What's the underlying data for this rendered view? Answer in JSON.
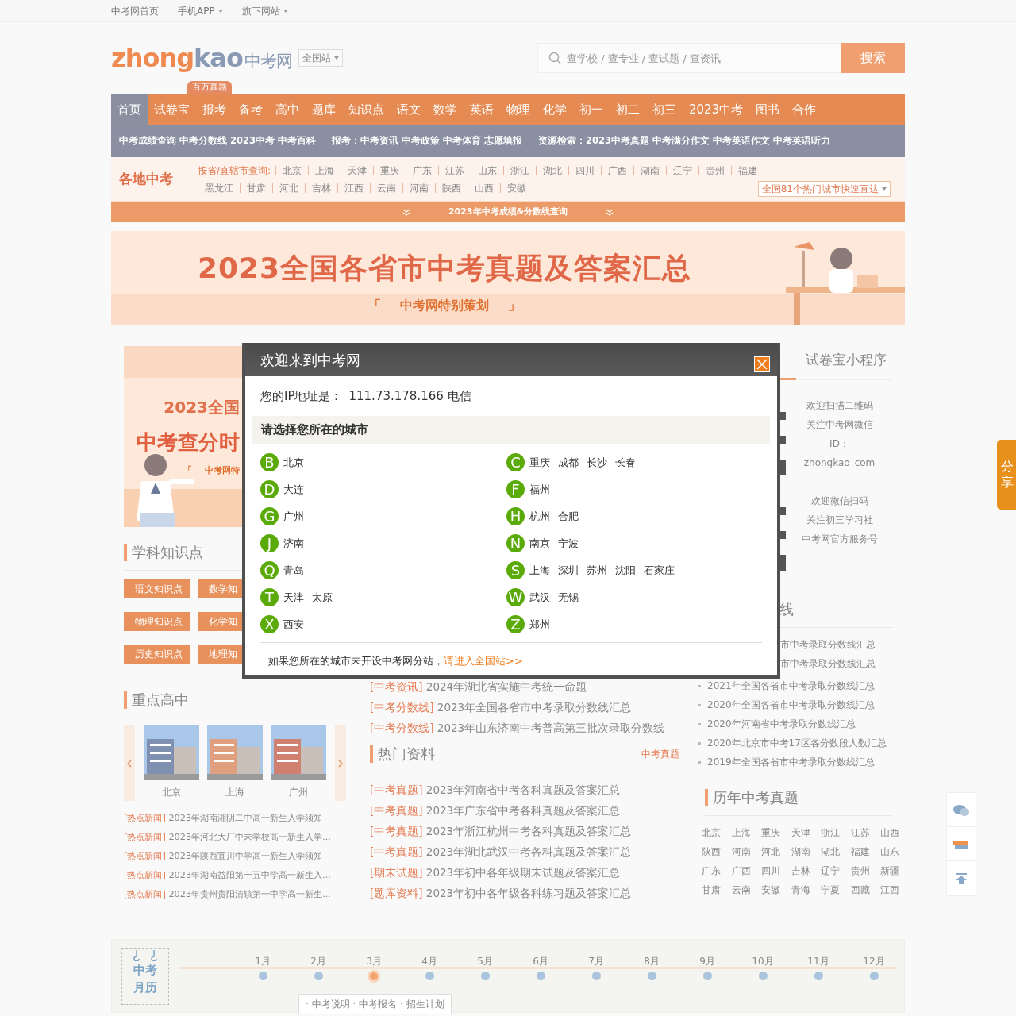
{
  "top_links": [
    {
      "label": "中考网首页",
      "dropdown": false
    },
    {
      "label": "手机APP",
      "dropdown": true
    },
    {
      "label": "旗下网站",
      "dropdown": true
    }
  ],
  "header": {
    "logo_a": "zhong",
    "logo_b": "kao",
    "logo_cn": "中考网",
    "site": "全国站",
    "search_placeholder": "查学校 / 查专业 / 查试题 / 查资讯",
    "search_button": "搜索"
  },
  "nav": {
    "badge": "百万真题",
    "items": [
      {
        "label": "首页",
        "selected": true
      },
      {
        "label": "试卷宝",
        "selected": false
      },
      {
        "label": "报考",
        "selected": false
      },
      {
        "label": "备考",
        "selected": false
      },
      {
        "label": "高中",
        "selected": false
      },
      {
        "label": "题库",
        "selected": false
      },
      {
        "label": "知识点",
        "selected": false
      },
      {
        "label": "语文",
        "selected": false
      },
      {
        "label": "数学",
        "selected": false
      },
      {
        "label": "英语",
        "selected": false
      },
      {
        "label": "物理",
        "selected": false
      },
      {
        "label": "化学",
        "selected": false
      },
      {
        "label": "初一",
        "selected": false
      },
      {
        "label": "初二",
        "selected": false
      },
      {
        "label": "初三",
        "selected": false
      },
      {
        "label": "2023中考",
        "selected": false
      },
      {
        "label": "图书",
        "selected": false
      },
      {
        "label": "合作",
        "selected": false
      }
    ]
  },
  "subnav": [
    {
      "links": [
        "中考成绩查询",
        "中考分数线",
        "2023中考",
        "中考百科"
      ]
    },
    {
      "label": "报考：",
      "links": [
        "中考资讯",
        "中考政策",
        "中考体育",
        "志愿填报"
      ]
    },
    {
      "label": "资源检索：",
      "links": [
        "2023中考真题",
        "中考满分作文",
        "中考英语作文",
        "中考英语听力"
      ]
    }
  ],
  "regions": {
    "title": "各地中考",
    "label": "按省/直辖市查询:",
    "cities": [
      "北京",
      "上海",
      "天津",
      "重庆",
      "广东",
      "江苏",
      "山东",
      "浙江",
      "湖北",
      "四川",
      "广西",
      "湖南",
      "辽宁",
      "贵州",
      "福建",
      "黑龙江",
      "甘肃",
      "河北",
      "吉林",
      "江西",
      "云南",
      "河南",
      "陕西",
      "山西",
      "安徽"
    ],
    "quick": "全国81个热门城市快速直达"
  },
  "score_bar": "2023年中考成绩&分数线查询",
  "banner": {
    "title": "2023全国各省市中考真题及答案汇总",
    "bracket_open": "「",
    "subtitle": "中考网特别策划",
    "bracket_close": "」"
  },
  "left": {
    "promo": {
      "line1": "2023全国",
      "line2": "中考查分时",
      "bracket": "「",
      "line3": "中考网特"
    },
    "subjects": {
      "title": "学科知识点",
      "buttons": [
        "语文知识点",
        "数学知",
        "物理知识点",
        "化学知",
        "历史知识点",
        "地理知"
      ]
    },
    "schools": {
      "title": "重点高中",
      "items": [
        {
          "kind": "picture",
          "city": "北京"
        },
        {
          "kind": "picture",
          "city": "上海"
        },
        {
          "kind": "picture",
          "city": "广州"
        }
      ]
    },
    "news": [
      {
        "tag": "[热点新闻]",
        "title": "2023年湖南湘阴二中高一新生入学须知"
      },
      {
        "tag": "[热点新闻]",
        "title": "2023年河北大厂中未学校高一新生入学..."
      },
      {
        "tag": "[热点新闻]",
        "title": "2023年陕西宜川中学高一新生入学须知"
      },
      {
        "tag": "[热点新闻]",
        "title": "2023年湖南益阳第十五中学高一新生入..."
      },
      {
        "tag": "[热点新闻]",
        "title": "2023年贵州贵阳清镇第一中学高一新生..."
      }
    ]
  },
  "middle": {
    "news": [
      {
        "tag": "[中考资讯]",
        "title": "2024年湖北省实施中考统一命题"
      },
      {
        "tag": "[中考分数线]",
        "title": "2023年全国各省市中考录取分数线汇总"
      },
      {
        "tag": "[中考分数线]",
        "title": "2023年山东济南中考普高第三批次录取分数线"
      }
    ],
    "hot": {
      "title": "热门资料",
      "more": "中考真题",
      "items": [
        {
          "tag": "[中考真题]",
          "title": "2023年河南省中考各科真题及答案汇总"
        },
        {
          "tag": "[中考真题]",
          "title": "2023年广东省中考各科真题及答案汇总"
        },
        {
          "tag": "[中考真题]",
          "title": "2023年浙江杭州中考各科真题及答案汇总"
        },
        {
          "tag": "[中考真题]",
          "title": "2023年湖北武汉中考各科真题及答案汇总"
        },
        {
          "tag": "[期末试题]",
          "title": "2023年初中各年级期末试题及答案汇总"
        },
        {
          "tag": "[题库资料]",
          "title": "2023年初中各年级各科练习题及答案汇总"
        }
      ]
    }
  },
  "right": {
    "tab": "试卷宝小程序",
    "qr": [
      {
        "lines": [
          "欢迎扫描二维码",
          "关注中考网微信",
          "ID：",
          "zhongkao_com"
        ]
      },
      {
        "lines": [
          "欢迎微信扫码",
          "关注初三学习社",
          "中考网官方服务号"
        ]
      }
    ],
    "scores": {
      "title_cut": "线",
      "items_cut": [
        "市中考录取分数线汇总",
        "市中考录取分数线汇总"
      ],
      "items": [
        "2021年全国各省市中考录取分数线汇总",
        "2020年全国各省市中考录取分数线汇总",
        "2020年河南省中考录取分数线汇总",
        "2020年北京市中考17区各分数段人数汇总",
        "2019年全国各省市中考录取分数线汇总"
      ]
    },
    "years": {
      "title": "历年中考真题",
      "provinces": [
        "北京",
        "上海",
        "重庆",
        "天津",
        "浙江",
        "江苏",
        "山西",
        "陕西",
        "河南",
        "河北",
        "湖南",
        "湖北",
        "福建",
        "山东",
        "广东",
        "广西",
        "四川",
        "吉林",
        "辽宁",
        "贵州",
        "新疆",
        "甘肃",
        "云南",
        "安徽",
        "青海",
        "宁夏",
        "西藏",
        "江西"
      ]
    }
  },
  "share": "分享",
  "calendar": {
    "title_top": "中考",
    "title_bottom": "月历",
    "months": [
      {
        "label": "1月",
        "selected": false
      },
      {
        "label": "2月",
        "selected": false
      },
      {
        "label": "3月",
        "selected": true
      },
      {
        "label": "4月",
        "selected": false
      },
      {
        "label": "5月",
        "selected": false
      },
      {
        "label": "6月",
        "selected": false
      },
      {
        "label": "7月",
        "selected": false
      },
      {
        "label": "8月",
        "selected": false
      },
      {
        "label": "9月",
        "selected": false
      },
      {
        "label": "10月",
        "selected": false
      },
      {
        "label": "11月",
        "selected": false
      },
      {
        "label": "12月",
        "selected": false
      }
    ],
    "tip": "· 中考说明 · 中考报名 · 招生计划"
  },
  "modal": {
    "title": "欢迎来到中考网",
    "ip_label": "您的IP地址是：",
    "ip_value": "111.73.178.166 电信",
    "prompt": "请选择您所在的城市",
    "groups": [
      {
        "letter": "B",
        "cities": [
          "北京"
        ]
      },
      {
        "letter": "C",
        "cities": [
          "重庆",
          "成都",
          "长沙",
          "长春"
        ]
      },
      {
        "letter": "D",
        "cities": [
          "大连"
        ]
      },
      {
        "letter": "F",
        "cities": [
          "福州"
        ]
      },
      {
        "letter": "G",
        "cities": [
          "广州"
        ]
      },
      {
        "letter": "H",
        "cities": [
          "杭州",
          "合肥"
        ]
      },
      {
        "letter": "J",
        "cities": [
          "济南"
        ]
      },
      {
        "letter": "N",
        "cities": [
          "南京",
          "宁波"
        ]
      },
      {
        "letter": "Q",
        "cities": [
          "青岛"
        ]
      },
      {
        "letter": "S",
        "cities": [
          "上海",
          "深圳",
          "苏州",
          "沈阳",
          "石家庄"
        ]
      },
      {
        "letter": "T",
        "cities": [
          "天津",
          "太原"
        ]
      },
      {
        "letter": "W",
        "cities": [
          "武汉",
          "无锡"
        ]
      },
      {
        "letter": "X",
        "cities": [
          "西安"
        ]
      },
      {
        "letter": "Z",
        "cities": [
          "郑州"
        ]
      }
    ],
    "footer": "如果您所在的城市未开设中考网分站，",
    "footer_link": "请进入全国站>>"
  }
}
